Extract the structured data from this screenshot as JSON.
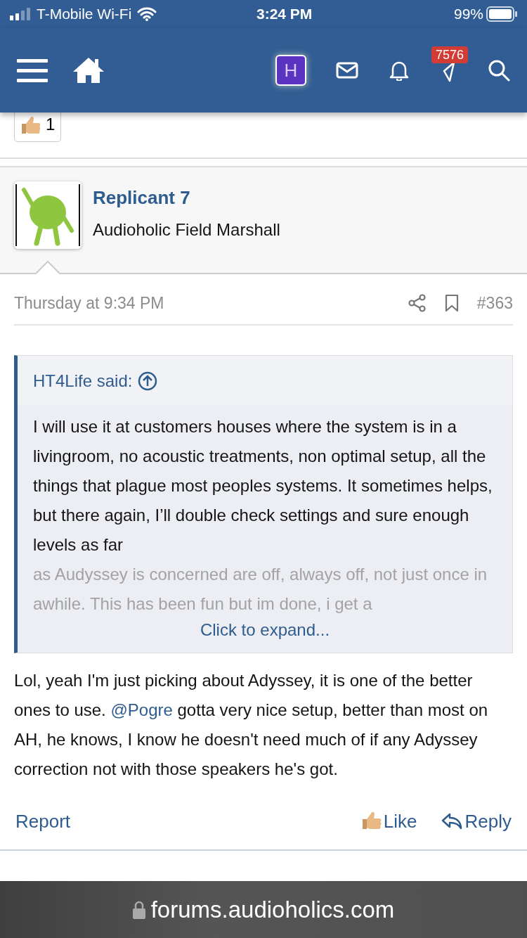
{
  "status_bar": {
    "carrier": "T-Mobile Wi-Fi",
    "time": "3:24 PM",
    "battery": "99%"
  },
  "navbar": {
    "avatar_letter": "H",
    "alerts_badge": "7576"
  },
  "reaction": {
    "count": "1"
  },
  "post": {
    "author": "Replicant 7",
    "user_title": "Audioholic Field Marshall",
    "date": "Thursday at 9:34 PM",
    "number": "#363",
    "quote": {
      "attribution": "HT4Life said:",
      "text": "I will use it at customers houses where the system is in a livingroom, no acoustic treatments, non optimal setup, all the things that plague most peoples systems. It sometimes helps, but there again, I’ll double check settings and sure enough levels as far",
      "faded_text": "as Audyssey is concerned are off, always off, not just once in awhile. This has been fun but im done, i get a",
      "expand": "Click to expand..."
    },
    "body": [
      {
        "kind": "text",
        "text": "Lol, yeah I'm just picking about Adyssey, it is one of the better ones to use. "
      },
      {
        "kind": "mention",
        "text": "@Pogre"
      },
      {
        "kind": "text",
        "text": " gotta very nice setup, better than most on AH, he knows, I know he doesn't need much of if any Adyssey correction not with those speakers he's got."
      }
    ],
    "actions": {
      "report": "Report",
      "like": "Like",
      "reply": "Reply"
    }
  },
  "url_bar": {
    "url": "forums.audioholics.com"
  }
}
